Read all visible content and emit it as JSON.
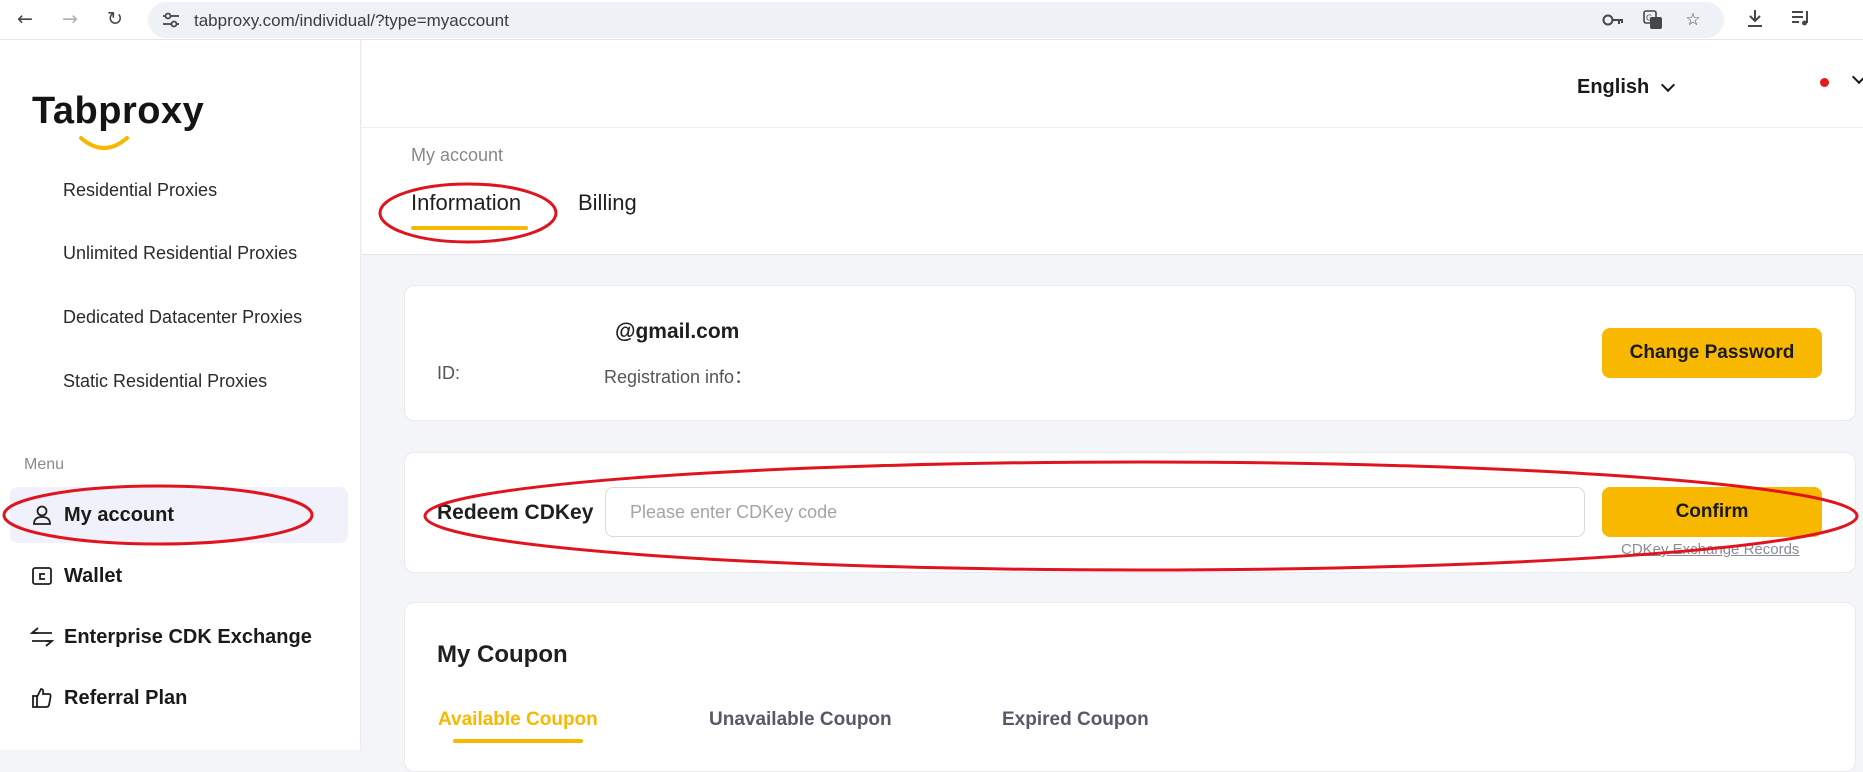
{
  "browser": {
    "url": "tabproxy.com/individual/?type=myaccount"
  },
  "sidebar": {
    "logo": "Tabproxy",
    "products": [
      {
        "label": "Residential Proxies"
      },
      {
        "label": "Unlimited Residential Proxies"
      },
      {
        "label": "Dedicated Datacenter Proxies"
      },
      {
        "label": "Static Residential Proxies"
      }
    ],
    "menu_caption": "Menu",
    "menu_items": [
      {
        "label": "My account",
        "icon": "user-icon",
        "active": true
      },
      {
        "label": "Wallet",
        "icon": "wallet-icon"
      },
      {
        "label": "Enterprise CDK Exchange",
        "icon": "exchange-icon"
      },
      {
        "label": "Referral Plan",
        "icon": "thumbs-up-icon"
      }
    ]
  },
  "topbar": {
    "language": "English"
  },
  "page": {
    "breadcrumb": "My account",
    "tabs": [
      {
        "label": "Information",
        "active": true
      },
      {
        "label": "Billing"
      }
    ]
  },
  "account_card": {
    "email": "@gmail.com",
    "id_label": "ID:",
    "registration_label": "Registration info：",
    "change_password_label": "Change Password"
  },
  "redeem_card": {
    "title": "Redeem CDKey",
    "input_placeholder": "Please enter CDKey code",
    "confirm_label": "Confirm",
    "records_link": "CDKey Exchange Records"
  },
  "coupon_card": {
    "title": "My Coupon",
    "tabs": [
      {
        "label": "Available Coupon",
        "active": true
      },
      {
        "label": "Unavailable Coupon"
      },
      {
        "label": "Expired Coupon"
      }
    ]
  },
  "colors": {
    "accent": "#f9b800",
    "annotation": "#e0141e",
    "active_menu_bg": "#f0f1fa"
  }
}
